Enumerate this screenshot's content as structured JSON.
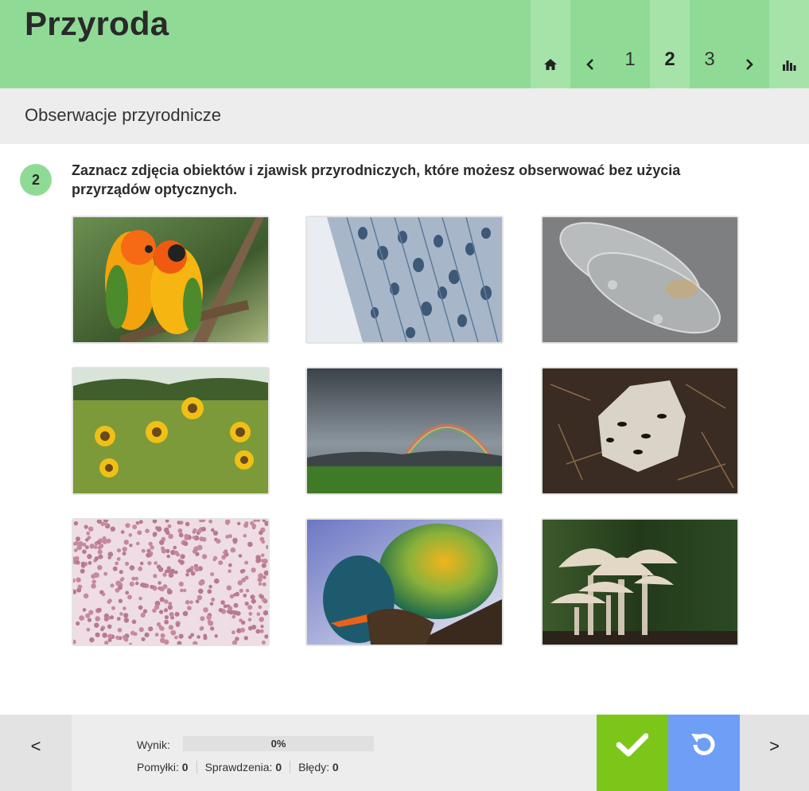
{
  "header": {
    "title": "Przyroda",
    "nav": {
      "home_icon": "home-icon",
      "prev_icon": "chevron-left-icon",
      "pages": [
        "1",
        "2",
        "3"
      ],
      "current_page": "2",
      "next_icon": "chevron-right-icon",
      "stats_icon": "bar-chart-icon"
    }
  },
  "section": {
    "title": "Obserwacje przyrodnicze"
  },
  "task": {
    "number": "2",
    "instruction": "Zaznacz zdjęcia obiektów i zjawisk przyrodniczych, które możesz obserwować bez użycia przyrządów optycznych."
  },
  "images": [
    "parrots-photo",
    "plant-cells-microscope-photo",
    "paramecium-microscope-photo",
    "sunflowers-photo",
    "rainbow-photo",
    "ants-on-stone-photo",
    "blood-cells-microscope-photo",
    "fly-eye-macro-photo",
    "mushrooms-photo"
  ],
  "footer": {
    "prev_label": "<",
    "next_label": ">",
    "check_icon": "checkmark-icon",
    "reset_icon": "reset-icon",
    "score_label": "Wynik:",
    "score_value": "0%",
    "score_fraction": 0,
    "mistakes_label": "Pomyłki:",
    "mistakes_value": "0",
    "checks_label": "Sprawdzenia:",
    "checks_value": "0",
    "errors_label": "Błędy:",
    "errors_value": "0"
  },
  "colors": {
    "header": "#8fdb96",
    "header_light": "#a6e3a9",
    "check_button": "#7cc61a",
    "reset_button": "#6f9ef7"
  }
}
